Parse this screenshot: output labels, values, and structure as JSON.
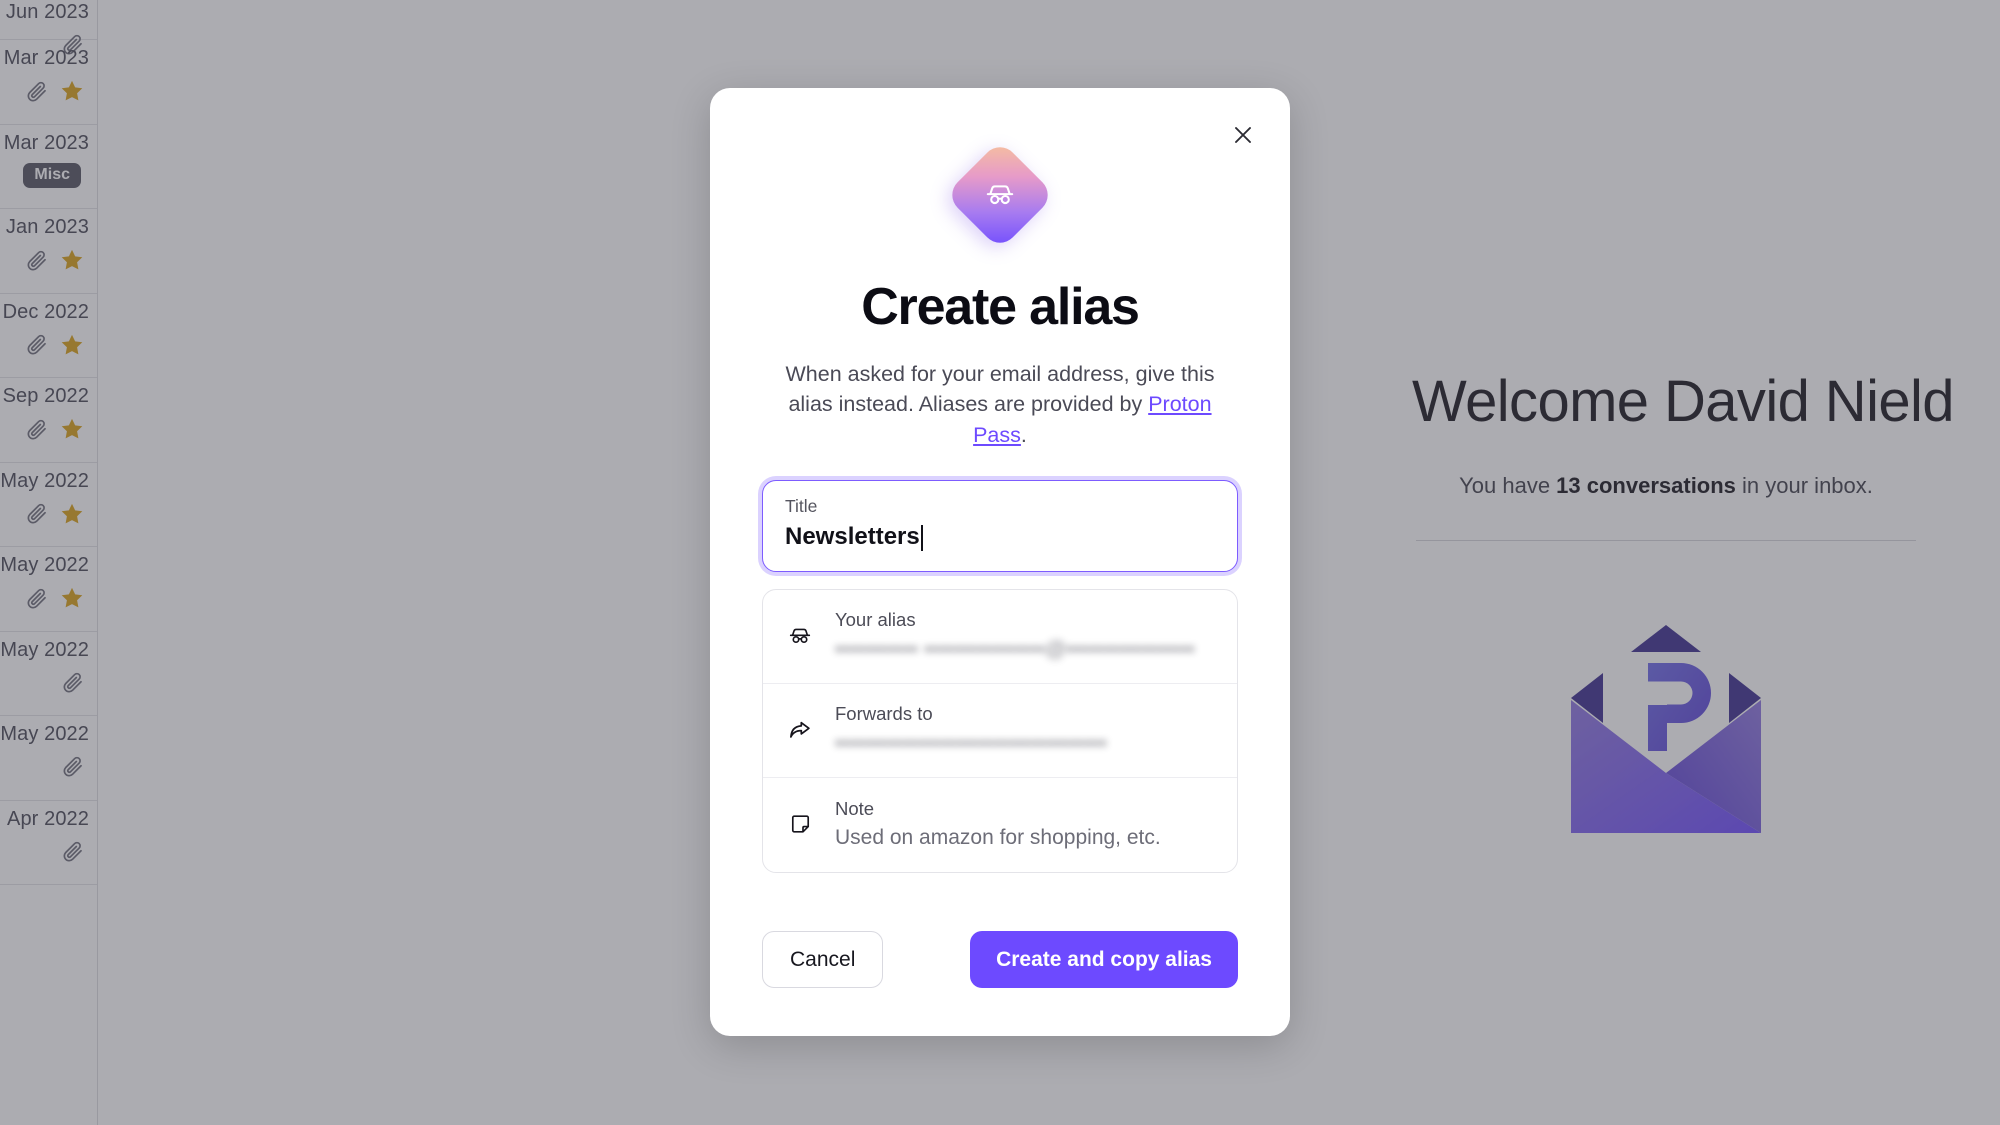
{
  "background": {
    "conversation_list": {
      "rows": [
        {
          "date": "Jun 2023",
          "attachment": true,
          "starred": false,
          "label": null
        },
        {
          "date": "Mar 2023",
          "attachment": true,
          "starred": true,
          "label": null
        },
        {
          "date": "Mar 2023",
          "attachment": false,
          "starred": false,
          "label": "Misc"
        },
        {
          "date": "Jan 2023",
          "attachment": true,
          "starred": true,
          "label": null
        },
        {
          "date": "Dec 2022",
          "attachment": true,
          "starred": true,
          "label": null
        },
        {
          "date": "Sep 2022",
          "attachment": true,
          "starred": true,
          "label": null
        },
        {
          "date": "May 2022",
          "attachment": true,
          "starred": true,
          "label": null
        },
        {
          "date": "May 2022",
          "attachment": true,
          "starred": true,
          "label": null
        },
        {
          "date": "May 2022",
          "attachment": true,
          "starred": false,
          "label": null
        },
        {
          "date": "May 2022",
          "attachment": true,
          "starred": false,
          "label": null
        },
        {
          "date": "Apr 2022",
          "attachment": true,
          "starred": false,
          "label": null
        }
      ]
    },
    "welcome": {
      "title": "Welcome David Nield",
      "subtitle_prefix": "You have ",
      "subtitle_strong": "13 conversations",
      "subtitle_suffix": " in your inbox.",
      "logo_name": "proton-mail-envelope-logo"
    }
  },
  "modal": {
    "close_label": "×",
    "hero_icon": "incognito-mask-icon",
    "title": "Create alias",
    "description_prefix": "When asked for your email address, give this alias instead. Aliases are provided by ",
    "description_link": "Proton Pass",
    "description_suffix": ".",
    "title_field": {
      "label": "Title",
      "value": "Newsletters",
      "placeholder": "Title",
      "focused": true
    },
    "details": [
      {
        "icon": "incognito-mask-icon",
        "label": "Your alias",
        "value": "••••••••••• ••••••••••••••••@•••••••••••••••••",
        "redacted": true
      },
      {
        "icon": "forward-arrow-icon",
        "label": "Forwards to",
        "value": "••••••••••••••••••••••••••••••••••••",
        "redacted": true
      },
      {
        "icon": "note-icon",
        "label": "Note",
        "value": "Used on amazon for shopping, etc.",
        "redacted": false
      }
    ],
    "cancel_label": "Cancel",
    "submit_label": "Create and copy alias"
  },
  "colors": {
    "accent": "#6d4aff",
    "star": "#d9a114",
    "badge_bg": "#53535f",
    "overlay": "rgba(70,70,82,0.45)"
  }
}
